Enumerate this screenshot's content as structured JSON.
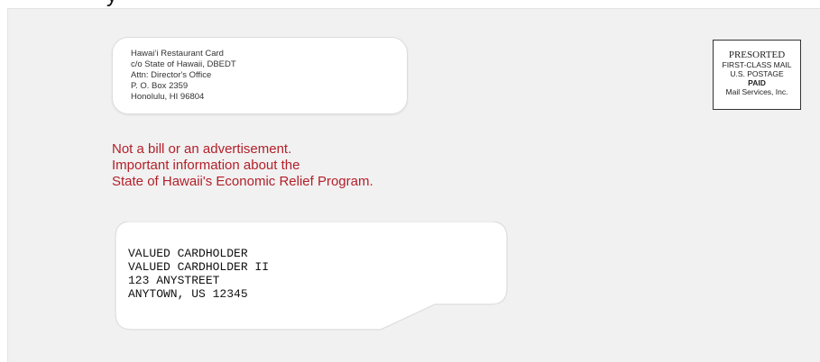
{
  "header": {
    "cropped_text": "y"
  },
  "return_address": {
    "lines": [
      "Hawaiʻi Restaurant Card",
      "c/o State of Hawaii, DBEDT",
      "Attn: Director's Office",
      "P. O. Box 2359",
      "Honolulu, HI 96804"
    ]
  },
  "postage": {
    "line1": "PRESORTED",
    "line2": "FIRST-CLASS MAIL",
    "line3": "U.S. POSTAGE",
    "line4": "PAID",
    "line5": "Mail Services, Inc."
  },
  "notice": {
    "lines": [
      "Not a bill or an advertisement.",
      "Important information about the",
      "State of Hawaii's Economic Relief Program."
    ],
    "color": "#b3202a"
  },
  "recipient": {
    "lines": [
      "VALUED CARDHOLDER",
      "VALUED CARDHOLDER II",
      "123 ANYSTREET",
      "ANYTOWN, US 12345"
    ]
  }
}
